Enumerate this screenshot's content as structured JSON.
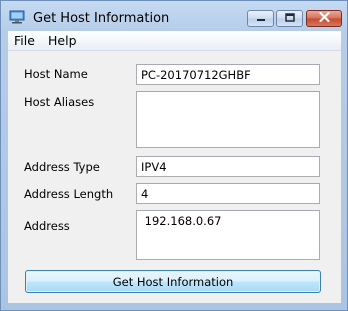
{
  "window": {
    "title": "Get Host Information"
  },
  "menu": {
    "items": [
      {
        "label": "File"
      },
      {
        "label": "Help"
      }
    ]
  },
  "form": {
    "host_name_label": "Host Name",
    "host_name_value": "PC-20170712GHBF",
    "host_aliases_label": "Host Aliases",
    "host_aliases_value": "",
    "address_type_label": "Address Type",
    "address_type_value": "IPV4",
    "address_length_label": "Address Length",
    "address_length_value": "4",
    "address_label": "Address",
    "address_value": " 192.168.0.67"
  },
  "actions": {
    "get_info_label": "Get Host Information"
  },
  "icons": {
    "app": "monitor-icon",
    "minimize": "minimize-icon",
    "maximize": "maximize-icon",
    "close": "close-icon"
  },
  "colors": {
    "close_button": "#c44c32",
    "titlebar": "#b6cde9"
  }
}
